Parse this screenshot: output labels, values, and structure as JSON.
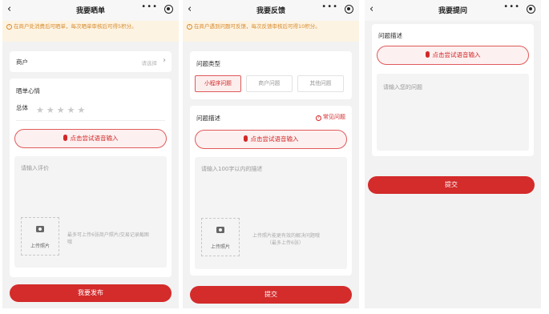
{
  "screens": [
    {
      "title": "我要晒单",
      "notice": "在商户处消费后可晒单，每次晒单审核后可得5积分。",
      "merchant_label": "商户",
      "merchant_placeholder": "请选择",
      "mood_label": "晒单心情",
      "overall_label": "总体",
      "rating": 0,
      "voice_label": "点击尝试语音输入",
      "review_placeholder": "请输入评价",
      "upload_label": "上传照片",
      "upload_hint": "最多可上传6张商户照片/交易记录截图哦",
      "submit_label": "我要发布"
    },
    {
      "title": "我要反馈",
      "notice": "在商户遇到问题可反馈，每次反馈审核后可得10积分。",
      "type_label": "问题类型",
      "types": [
        "小程序问题",
        "商户问题",
        "其他问题"
      ],
      "selected_type": "小程序问题",
      "desc_label": "问题描述",
      "faq_label": "常见问题",
      "voice_label": "点击尝试语音输入",
      "desc_placeholder": "请输入100字以内的描述",
      "upload_label": "上传照片",
      "upload_hint_line1": "上传照片能更有效的解决问题哦",
      "upload_hint_line2": "（最多上传6张）",
      "submit_label": "提交"
    },
    {
      "title": "我要提问",
      "desc_label": "问题描述",
      "voice_label": "点击尝试语音输入",
      "question_placeholder": "请输入您的问题",
      "submit_label": "提交"
    }
  ],
  "nav": {
    "back_icon": "‹",
    "more_icon": "•••"
  },
  "colors": {
    "accent": "#d42b2b",
    "notice_bg": "#fdf3e2",
    "notice_text": "#d68b2f",
    "page_bg": "#f2f2f2"
  }
}
